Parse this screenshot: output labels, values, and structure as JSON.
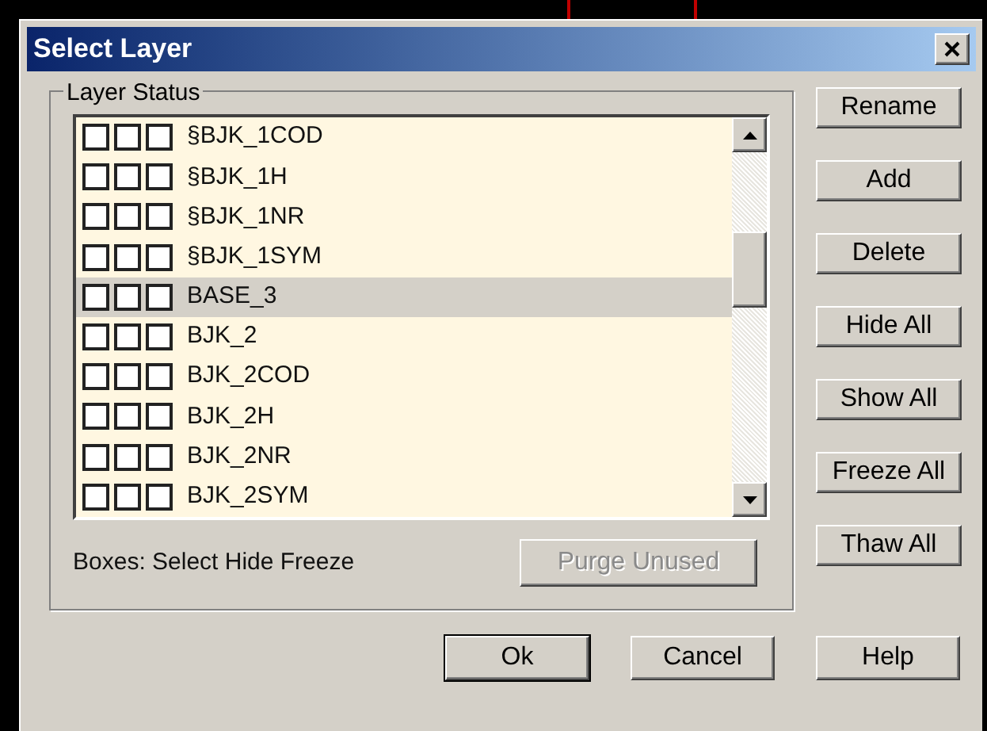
{
  "window": {
    "title": "Select Layer"
  },
  "group": {
    "label": "Layer Status"
  },
  "layers": [
    {
      "name": "§BJK_1COD",
      "selected": false,
      "select": false,
      "hide": false,
      "freeze": false
    },
    {
      "name": "§BJK_1H",
      "selected": false,
      "select": false,
      "hide": false,
      "freeze": false
    },
    {
      "name": "§BJK_1NR",
      "selected": false,
      "select": false,
      "hide": false,
      "freeze": false
    },
    {
      "name": "§BJK_1SYM",
      "selected": false,
      "select": false,
      "hide": false,
      "freeze": false
    },
    {
      "name": "BASE_3",
      "selected": true,
      "select": false,
      "hide": false,
      "freeze": false
    },
    {
      "name": "BJK_2",
      "selected": false,
      "select": false,
      "hide": false,
      "freeze": false
    },
    {
      "name": "BJK_2COD",
      "selected": false,
      "select": false,
      "hide": false,
      "freeze": false
    },
    {
      "name": "BJK_2H",
      "selected": false,
      "select": false,
      "hide": false,
      "freeze": false
    },
    {
      "name": "BJK_2NR",
      "selected": false,
      "select": false,
      "hide": false,
      "freeze": false
    },
    {
      "name": "BJK_2SYM",
      "selected": false,
      "select": false,
      "hide": false,
      "freeze": false
    }
  ],
  "legend": "Boxes: Select Hide Freeze",
  "purge_button": {
    "label": "Purge Unused",
    "disabled": true
  },
  "side_buttons": [
    "Rename",
    "Add",
    "Delete",
    "Hide All",
    "Show All",
    "Freeze All",
    "Thaw All"
  ],
  "bottom_buttons": [
    {
      "label": "Ok",
      "default": true
    },
    {
      "label": "Cancel",
      "default": false
    },
    {
      "label": "Help",
      "default": false
    }
  ]
}
